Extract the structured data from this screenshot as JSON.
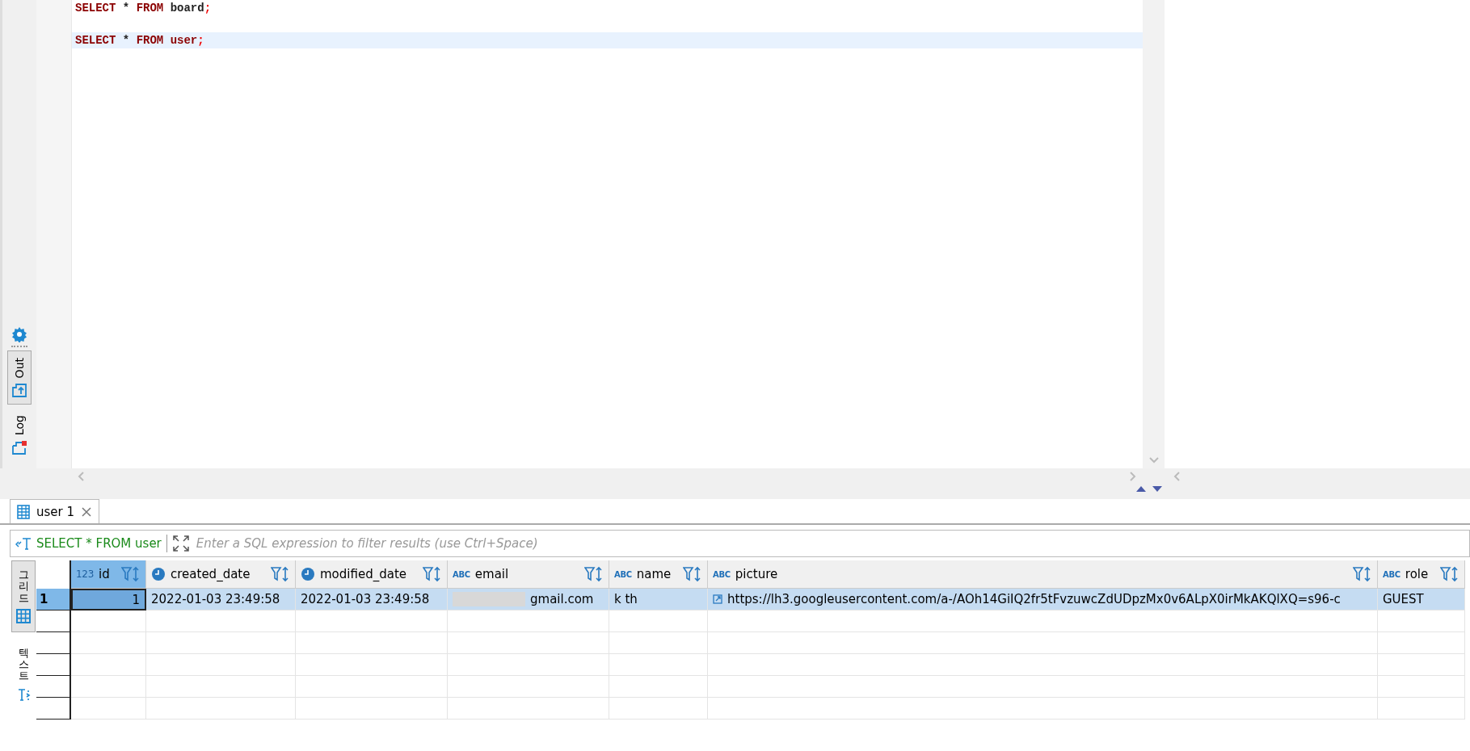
{
  "editor": {
    "lines": [
      {
        "current": false,
        "tokens": [
          {
            "kind": "keyword",
            "text": "SELECT"
          },
          {
            "kind": "plain",
            "text": " * "
          },
          {
            "kind": "keyword",
            "text": "FROM"
          },
          {
            "kind": "plain",
            "text": " board"
          },
          {
            "kind": "punct",
            "text": ";"
          }
        ]
      },
      {
        "current": true,
        "tokens": [
          {
            "kind": "keyword",
            "text": "SELECT"
          },
          {
            "kind": "plain",
            "text": " * "
          },
          {
            "kind": "keyword",
            "text": "FROM"
          },
          {
            "kind": "keyword",
            "text": " user"
          },
          {
            "kind": "punct",
            "text": ";"
          }
        ]
      }
    ]
  },
  "side_tabs": [
    {
      "label": "Out",
      "kind": "output",
      "selected": true
    },
    {
      "label": "Log",
      "kind": "log",
      "selected": false
    }
  ],
  "results": {
    "tab": {
      "label": "user 1"
    },
    "query": "SELECT * FROM user",
    "filter": {
      "placeholder": "Enter a SQL expression to filter results (use Ctrl+Space)"
    },
    "view_tabs": [
      {
        "label": "그리드",
        "kind": "grid",
        "selected": true
      },
      {
        "label": "텍스트",
        "kind": "text",
        "selected": false
      }
    ],
    "columns": [
      {
        "name": "id",
        "kind": "number",
        "type_label": "123",
        "selected": true
      },
      {
        "name": "created_date",
        "kind": "date",
        "selected": false
      },
      {
        "name": "modified_date",
        "kind": "date",
        "selected": false
      },
      {
        "name": "email",
        "kind": "string",
        "type_label": "ABC",
        "selected": false
      },
      {
        "name": "name",
        "kind": "string",
        "type_label": "ABC",
        "selected": false
      },
      {
        "name": "picture",
        "kind": "string",
        "type_label": "ABC",
        "selected": false
      },
      {
        "name": "role",
        "kind": "string",
        "type_label": "ABC",
        "selected": false
      }
    ],
    "rows": [
      {
        "number": "1",
        "selected": true,
        "cells": [
          {
            "kind": "number",
            "text": "1",
            "redacted": false
          },
          {
            "kind": "text",
            "text": "2022-01-03 23:49:58",
            "redacted": false
          },
          {
            "kind": "text",
            "text": "2022-01-03 23:49:58",
            "redacted": false
          },
          {
            "kind": "text",
            "text": "gmail.com",
            "redacted": true
          },
          {
            "kind": "text",
            "text": "k th",
            "redacted": false
          },
          {
            "kind": "link",
            "text": "https://lh3.googleusercontent.com/a-/AOh14GiIQ2fr5tFvzuwcZdUDpzMx0v6ALpX0irMkAKQlXQ=s96-c",
            "redacted": false
          },
          {
            "kind": "text",
            "text": "GUEST",
            "redacted": false
          }
        ]
      }
    ]
  }
}
